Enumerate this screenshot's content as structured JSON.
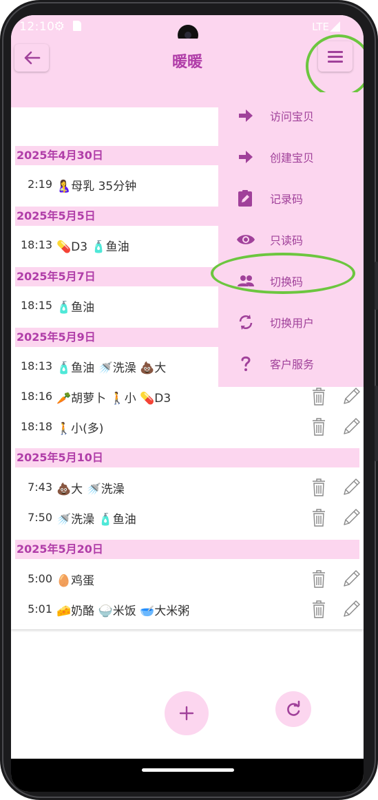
{
  "status_bar": {
    "time": "12:10",
    "network": "LTE"
  },
  "app_bar": {
    "title": "暖暖"
  },
  "menu": {
    "items": [
      {
        "label": "访问宝贝",
        "icon": "arrow-right-icon"
      },
      {
        "label": "创建宝贝",
        "icon": "arrow-right-icon"
      },
      {
        "label": "记录码",
        "icon": "clipboard-edit-icon"
      },
      {
        "label": "只读码",
        "icon": "eye-icon"
      },
      {
        "label": "切换码",
        "icon": "people-icon"
      },
      {
        "label": "切换用户",
        "icon": "sync-icon"
      },
      {
        "label": "客户服务",
        "icon": "question-icon"
      }
    ]
  },
  "records": [
    {
      "date": "2025年4月30日",
      "entries": [
        {
          "time": "2:19",
          "items": "🤱母乳 35分钟"
        }
      ]
    },
    {
      "date": "2025年5月5日",
      "entries": [
        {
          "time": "18:13",
          "items": "💊D3 🧴鱼油"
        }
      ]
    },
    {
      "date": "2025年5月7日",
      "entries": [
        {
          "time": "18:15",
          "items": "🧴鱼油"
        }
      ]
    },
    {
      "date": "2025年5月9日",
      "entries": [
        {
          "time": "18:13",
          "items": "🧴鱼油 🚿洗澡 💩大"
        },
        {
          "time": "18:16",
          "items": "🥕胡萝卜 🚶小 💊D3"
        },
        {
          "time": "18:18",
          "items": "🚶小(多)"
        }
      ]
    },
    {
      "date": "2025年5月10日",
      "entries": [
        {
          "time": "7:43",
          "items": "💩大 🚿洗澡"
        },
        {
          "time": "7:50",
          "items": "🚿洗澡 🧴鱼油"
        }
      ]
    },
    {
      "date": "2025年5月20日",
      "entries": [
        {
          "time": "5:00",
          "items": "🥚鸡蛋"
        },
        {
          "time": "5:01",
          "items": "🧀奶酪 🍚米饭 🥣大米粥"
        }
      ]
    }
  ],
  "colors": {
    "accent": "#a0419a",
    "header_bg": "#fcd6ef",
    "highlight": "#6cc63f"
  }
}
